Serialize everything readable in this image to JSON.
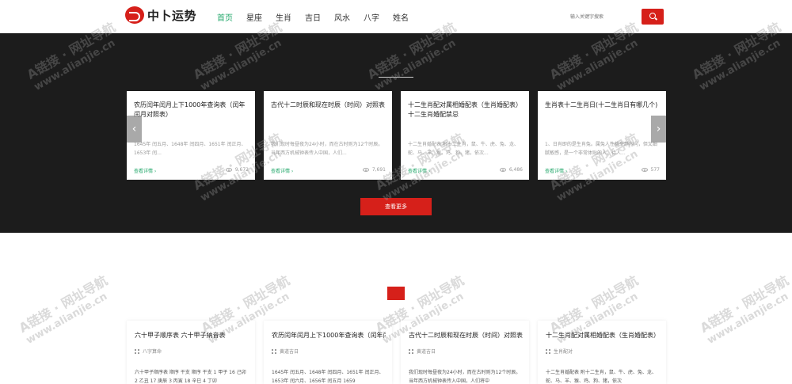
{
  "header": {
    "logo_text": "中卜运势",
    "nav": [
      {
        "label": "首页",
        "active": true
      },
      {
        "label": "星座",
        "active": false
      },
      {
        "label": "生肖",
        "active": false
      },
      {
        "label": "吉日",
        "active": false
      },
      {
        "label": "风水",
        "active": false
      },
      {
        "label": "八字",
        "active": false
      },
      {
        "label": "姓名",
        "active": false
      }
    ],
    "search_placeholder": "输入关键字搜索"
  },
  "featured": {
    "cards": [
      {
        "title": "农历闰年闰月上下1000年查询表（闰年闰月对照表）",
        "desc": "1645年 闰五月、1648年 闰四月、1651年 闰正月、1653年 闰...",
        "more": "查看详情",
        "views": "9,672"
      },
      {
        "title": "古代十二时辰和现在时辰（时间）对照表",
        "desc": "我们现时每昼夜为24小时，而在古时则为12个时辰。当年西方机械钟表传入中国，人们...",
        "more": "查看详情",
        "views": "7,691"
      },
      {
        "title": "十二生肖配对属相婚配表（生肖婚配表）十二生肖婚配禁忌",
        "desc": "十二生肖婚配表 附十二生肖，鼠、牛、虎、兔、龙、蛇、马、羊、猴、鸡、狗、猪，依次...",
        "more": "查看详情",
        "views": "6,486"
      },
      {
        "title": "生肖表十二生肖日(十二生肖日有哪几个)",
        "desc": "1、日肖即的是生肖兔。属兔人性格平静内向，但又细腻敏感，是一个非常体贴的人，待人...",
        "more": "查看详情",
        "views": "577"
      }
    ],
    "prev_icon": "‹",
    "next_icon": "›",
    "more_button": "查看更多"
  },
  "latest": {
    "cards": [
      {
        "title": "六十甲子顺序表 六十甲子納音表",
        "category": "八字算命",
        "desc": "六十甲子顺序表 顺序 干支 顺序 干支 1 甲子 16 己卯 2 乙丑 17 庚辰 3 丙寅 18 辛巳 4 丁卯"
      },
      {
        "title": "农历闰年闰月上下1000年查询表（闰年闰月对照表）",
        "category": "黄道吉日",
        "desc": "1645年 闰五月、1648年 闰四月、1651年 闰正月、1653年 闰六月、1656年 闰五月 1659"
      },
      {
        "title": "古代十二时辰和现在时辰（时间）对照表",
        "category": "黄道吉日",
        "desc": "我们现时每昼夜为24小时，而在古时则为12个时辰。当年西方机械钟表传入中国，人们将中"
      },
      {
        "title": "十二生肖配对属相婚配表（生肖婚配表）",
        "category": "生肖配对",
        "desc": "十二生肖婚配表 附十二生肖，鼠、牛、虎、兔、龙、蛇、马、羊、猴、鸡、狗、猪，依次"
      }
    ]
  },
  "watermark": {
    "line1": "A链接 · 网址导航",
    "line2": "www.alianjie.cn"
  }
}
